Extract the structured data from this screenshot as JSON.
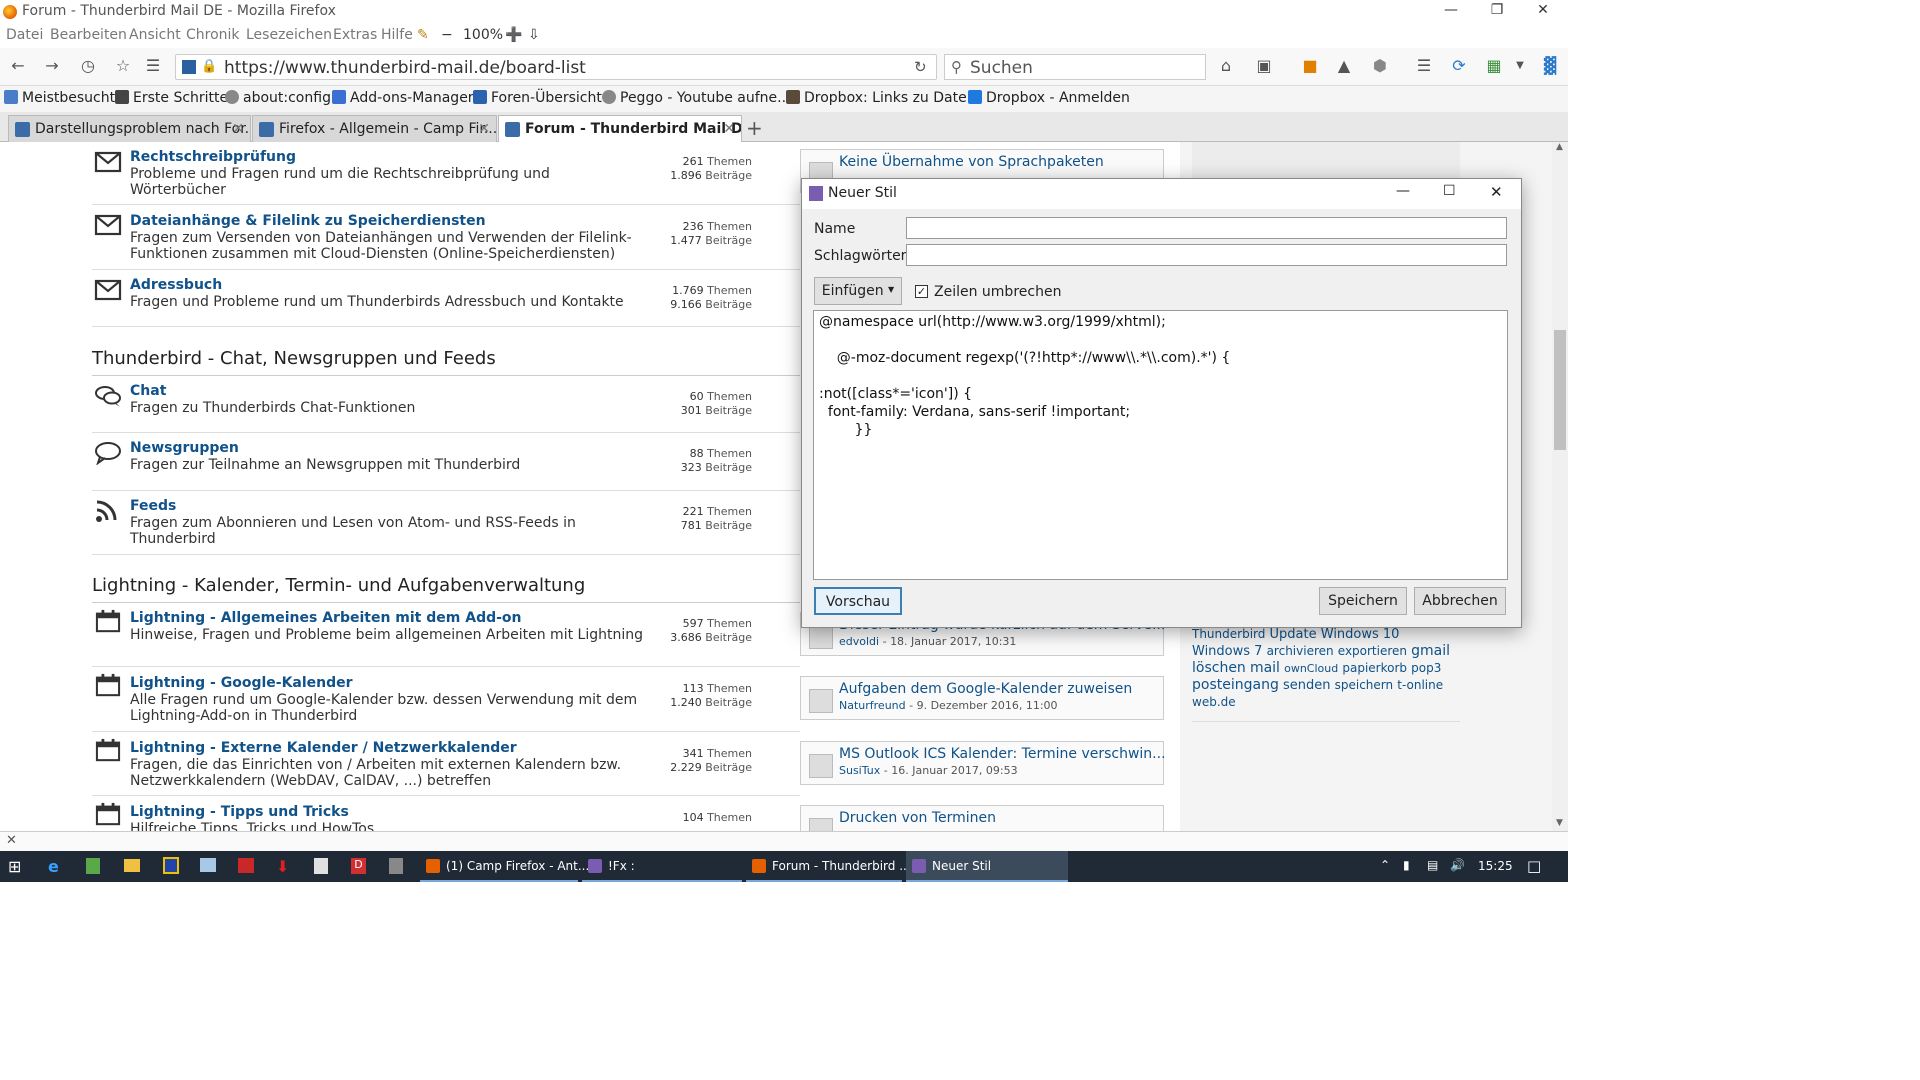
{
  "window": {
    "title": "Forum - Thunderbird Mail DE - Mozilla Firefox"
  },
  "menubar": [
    "Datei",
    "Bearbeiten",
    "Ansicht",
    "Chronik",
    "Lesezeichen",
    "Extras",
    "Hilfe"
  ],
  "zoom": "100%",
  "url": "https://www.thunderbird-mail.de/board-list",
  "search_placeholder": "Suchen",
  "bookmarks": [
    "Meistbesucht",
    "Erste Schritte",
    "about:config",
    "Add-ons-Manager",
    "Foren-Übersicht",
    "Peggo - Youtube aufne...",
    "Dropbox: Links zu Date...",
    "Dropbox - Anmelden"
  ],
  "tabs": [
    {
      "label": "Darstellungsproblem nach For..."
    },
    {
      "label": "Firefox - Allgemein - Camp Fir..."
    },
    {
      "label": "Forum - Thunderbird Mail DE"
    }
  ],
  "forum": {
    "stat_labels": {
      "threads": "Themen",
      "posts": "Beiträge"
    },
    "rows_top": [
      {
        "title": "Rechtschreibprüfung",
        "desc": "Probleme und Fragen rund um die Rechtschreibprüfung und Wörterbücher",
        "threads": "261",
        "posts": "1.896",
        "icon": "envelope-icon"
      },
      {
        "title": "Dateianhänge & Filelink zu Speicherdiensten",
        "desc": "Fragen zum Versenden von Dateianhängen und Verwenden der Filelink-Funktionen zusammen mit Cloud-Diensten (Online-Speicherdiensten)",
        "threads": "236",
        "posts": "1.477",
        "icon": "envelope-icon"
      },
      {
        "title": "Adressbuch",
        "desc": "Fragen und Probleme rund um Thunderbirds Adressbuch und Kontakte",
        "threads": "1.769",
        "posts": "9.166",
        "icon": "envelope-icon"
      }
    ],
    "section_chat": "Thunderbird - Chat, Newsgruppen und Feeds",
    "rows_chat": [
      {
        "title": "Chat",
        "desc": "Fragen zu Thunderbirds Chat-Funktionen",
        "threads": "60",
        "posts": "301",
        "icon": "chat-bubbles-icon"
      },
      {
        "title": "Newsgruppen",
        "desc": "Fragen zur Teilnahme an Newsgruppen mit Thunderbird",
        "threads": "88",
        "posts": "323",
        "icon": "speech-bubble-icon"
      },
      {
        "title": "Feeds",
        "desc": "Fragen zum Abonnieren und Lesen von Atom- und RSS-Feeds in Thunderbird",
        "threads": "221",
        "posts": "781",
        "icon": "rss-icon"
      }
    ],
    "section_lightning": "Lightning - Kalender, Termin- und Aufgabenverwaltung",
    "rows_lightning": [
      {
        "title": "Lightning - Allgemeines Arbeiten mit dem Add-on",
        "desc": "Hinweise, Fragen und Probleme beim allgemeinen Arbeiten mit Lightning",
        "threads": "597",
        "posts": "3.686",
        "icon": "calendar-icon"
      },
      {
        "title": "Lightning - Google-Kalender",
        "desc": "Alle Fragen rund um Google-Kalender bzw. dessen Verwendung mit dem Lightning-Add-on in Thunderbird",
        "threads": "113",
        "posts": "1.240",
        "icon": "calendar-icon"
      },
      {
        "title": "Lightning - Externe Kalender / Netzwerkkalender",
        "desc": "Fragen, die das Einrichten von / Arbeiten mit externen Kalendern bzw. Netzwerkkalendern (WebDAV, CalDAV, ...) betreffen",
        "threads": "341",
        "posts": "2.229",
        "icon": "calendar-icon"
      },
      {
        "title": "Lightning - Tipps und Tricks",
        "desc": "Hilfreiche Tipps, Tricks und HowTos",
        "threads": "104",
        "posts": "",
        "icon": "calendar-icon"
      }
    ],
    "last_posts": [
      {
        "title": "Keine Übernahme von Sprachpaketen",
        "author": "",
        "date": ""
      },
      {
        "title": "Dieser Eintrag wurde kürzlich auf dem Serve...",
        "author": "edvoldi",
        "date": "18. Januar 2017, 10:31"
      },
      {
        "title": "Aufgaben dem Google-Kalender zuweisen",
        "author": "Naturfreund",
        "date": "9. Dezember 2016, 11:00"
      },
      {
        "title": "MS Outlook ICS Kalender: Termine verschwin...",
        "author": "SusiTux",
        "date": "16. Januar 2017, 09:53"
      },
      {
        "title": "Drucken von Terminen",
        "author": "",
        "date": ""
      }
    ],
    "tags": [
      {
        "text": "Thunderbird",
        "size": 12
      },
      {
        "text": "Update",
        "size": 13
      },
      {
        "text": "Windows 10",
        "size": 13
      },
      {
        "text": "Windows 7",
        "size": 13
      },
      {
        "text": "archivieren",
        "size": 12
      },
      {
        "text": "exportieren",
        "size": 12
      },
      {
        "text": "gmail",
        "size": 14
      },
      {
        "text": "löschen",
        "size": 14
      },
      {
        "text": "mail",
        "size": 14
      },
      {
        "text": "ownCloud",
        "size": 11
      },
      {
        "text": "papierkorb",
        "size": 12
      },
      {
        "text": "pop3",
        "size": 12
      },
      {
        "text": "posteingang",
        "size": 14
      },
      {
        "text": "senden",
        "size": 13
      },
      {
        "text": "speichern",
        "size": 12
      },
      {
        "text": "t-online",
        "size": 12
      },
      {
        "text": "web.de",
        "size": 12
      }
    ]
  },
  "dialog": {
    "title": "Neuer Stil",
    "name_label": "Name",
    "tags_label": "Schlagwörter",
    "name_value": "",
    "tags_value": "",
    "insert_button": "Einfügen",
    "wrap_checkbox": "Zeilen umbrechen",
    "wrap_checked": true,
    "code_lines": [
      "@namespace url(http://www.w3.org/1999/xhtml);",
      "",
      "    @-moz-document regexp('(?!http*://www\\\\.*\\\\.com).*') {",
      "",
      ":not([class*='icon']) {",
      "  font-family: Verdana, sans-serif !important;",
      "        }}"
    ],
    "preview_button": "Vorschau",
    "save_button": "Speichern",
    "cancel_button": "Abbrechen"
  },
  "taskbar": {
    "windows": [
      {
        "label": "(1) Camp Firefox - Ant...",
        "active": false
      },
      {
        "label": "!Fx :",
        "active": false
      },
      {
        "label": "Forum - Thunderbird ...",
        "active": false
      },
      {
        "label": "Neuer Stil",
        "active": true
      }
    ],
    "clock": "15:25"
  }
}
